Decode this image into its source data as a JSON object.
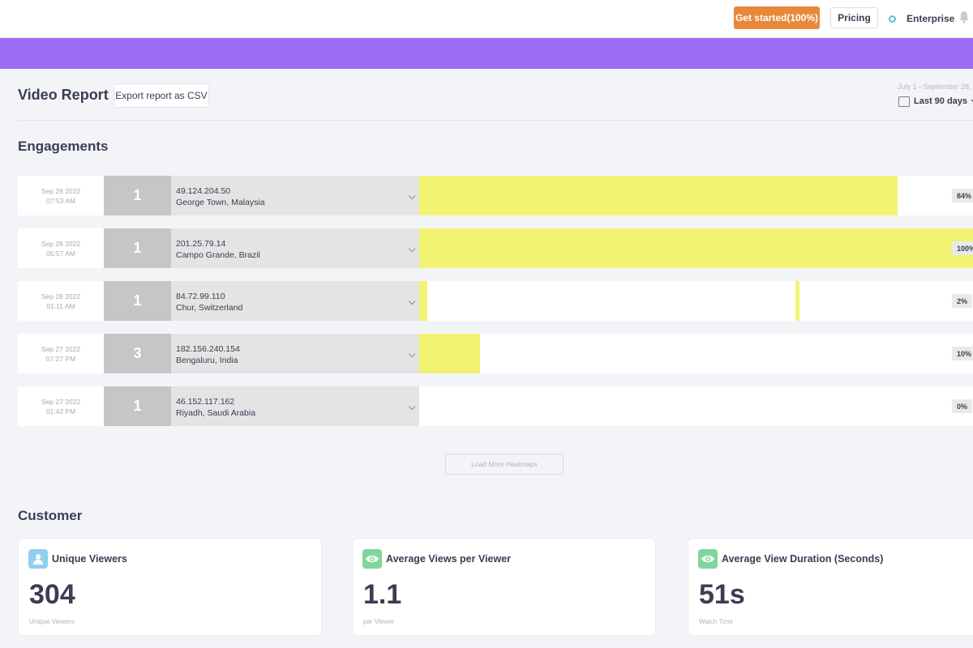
{
  "topbar": {
    "get_started_label": "Get started(100%)",
    "pricing_label": "Pricing",
    "enterprise_label": "Enterprise"
  },
  "header": {
    "title": "Video Report",
    "export_label": "Export report as CSV",
    "date_range": "July 1 - September 28,",
    "range_select": "Last 90 days"
  },
  "engagements": {
    "title": "Engagements",
    "rows": [
      {
        "date": "Sep 28 2022",
        "time": "07:53 AM",
        "count": "1",
        "ip": "49.124.204.50",
        "location": "George Town, Malaysia",
        "percent": "84%",
        "segments": [
          [
            0,
            0.864
          ]
        ]
      },
      {
        "date": "Sep 28 2022",
        "time": "05:57 AM",
        "count": "1",
        "ip": "201.25.79.14",
        "location": "Campo Grande, Brazil",
        "percent": "100%",
        "segments": [
          [
            0,
            1.0
          ]
        ]
      },
      {
        "date": "Sep 28 2022",
        "time": "01:11 AM",
        "count": "1",
        "ip": "84.72.99.110",
        "location": "Chur, Switzerland",
        "percent": "2%",
        "segments": [
          [
            0,
            0.015
          ],
          [
            0.68,
            0.687
          ]
        ]
      },
      {
        "date": "Sep 27 2022",
        "time": "07:27 PM",
        "count": "3",
        "ip": "182.156.240.154",
        "location": "Bengaluru, India",
        "percent": "10%",
        "segments": [
          [
            0,
            0.11
          ]
        ]
      },
      {
        "date": "Sep 27 2022",
        "time": "01:42 PM",
        "count": "1",
        "ip": "46.152.117.162",
        "location": "Riyadh, Saudi Arabia",
        "percent": "0%",
        "segments": []
      }
    ],
    "load_more_label": "Load More Heatmaps"
  },
  "customer": {
    "title": "Customer",
    "cards": [
      {
        "title": "Unique Viewers",
        "value": "304",
        "sub": "Unique Viewers",
        "icon": "user-icon",
        "icon_color": "#8fd0ef"
      },
      {
        "title": "Average Views per Viewer",
        "value": "1.1",
        "sub": "per Viewer",
        "icon": "eye-icon",
        "icon_color": "#7fd69a"
      },
      {
        "title": "Average View Duration (Seconds)",
        "value": "51s",
        "sub": "Watch Time",
        "icon": "eye-icon",
        "icon_color": "#7fd69a"
      }
    ]
  },
  "colors": {
    "accent_orange": "#e8883a",
    "banner_purple": "#9b6cf6",
    "heat_yellow": "#f3f373"
  }
}
